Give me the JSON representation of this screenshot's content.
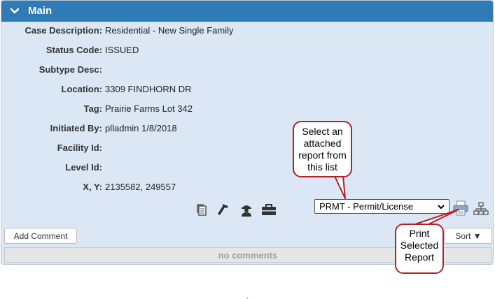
{
  "section": {
    "title": "Main"
  },
  "fields": [
    {
      "label": "Case Description:",
      "value": "Residential - New Single Family"
    },
    {
      "label": "Status Code:",
      "value": "ISSUED"
    },
    {
      "label": "Subtype Desc:",
      "value": ""
    },
    {
      "label": "Location:",
      "value": "3309 FINDHORN DR"
    },
    {
      "label": "Tag:",
      "value": "Prairie Farms Lot 342"
    },
    {
      "label": "Initiated By:",
      "value": "plladmin 1/8/2018"
    },
    {
      "label": "Facility Id:",
      "value": ""
    },
    {
      "label": "Level Id:",
      "value": ""
    },
    {
      "label": "X, Y:",
      "value": "2135582, 249557"
    }
  ],
  "toolbar": {
    "icons": [
      "copy-icon",
      "hammer-icon",
      "inspector-icon",
      "briefcase-icon"
    ]
  },
  "report_select": {
    "selected": "PRMT - Permit/License"
  },
  "buttons": {
    "add_comment": "Add Comment",
    "sort": "Sort ▼"
  },
  "comments": {
    "empty_text": "no comments"
  },
  "callouts": {
    "select_report": [
      "Select an",
      "attached",
      "report from",
      "this list"
    ],
    "print_report": [
      "Print",
      "Selected",
      "Report"
    ]
  },
  "colors": {
    "header": "#2e7bb8",
    "panel": "#dbe7f4",
    "callout_border": "#b3202a"
  }
}
